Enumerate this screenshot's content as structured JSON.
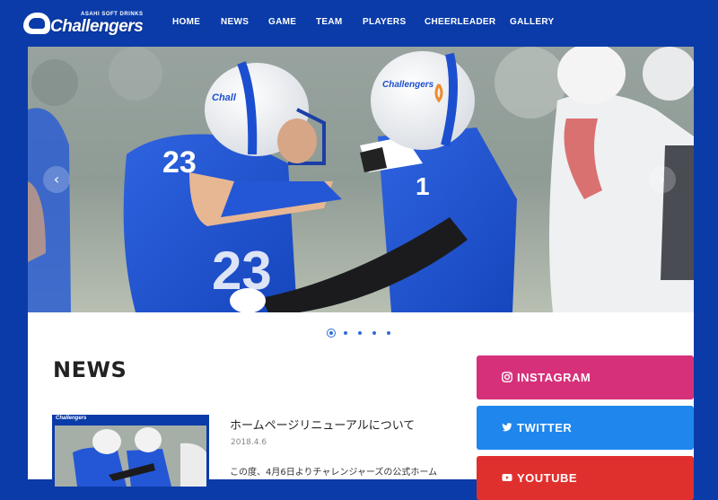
{
  "header": {
    "logo_small": "ASAHI SOFT DRINKS",
    "logo_big": "Challengers",
    "nav": [
      {
        "label": "HOME"
      },
      {
        "label": "NEWS"
      },
      {
        "label": "GAME"
      },
      {
        "label": "TEAM"
      },
      {
        "label": "PLAYERS"
      },
      {
        "label": "CHEERLEADER"
      },
      {
        "label": "GALLERY"
      }
    ]
  },
  "hero": {
    "prev_arrow": "‹",
    "next_arrow": "›",
    "slide_count": 5,
    "active_slide": 1,
    "jersey_left": "23",
    "jersey_center": "1",
    "helmet_text": "Challengers"
  },
  "news": {
    "heading": "NEWS",
    "post": {
      "title": "ホームページリニューアルについて",
      "date": "2018.4.6",
      "excerpt": "この度、4月6日よりチャレンジャーズの公式ホーム"
    },
    "thumb_logo": "Challengers"
  },
  "social": [
    {
      "label": "INSTAGRAM",
      "color": "#d6307a",
      "icon": "instagram-icon"
    },
    {
      "label": "TWITTER",
      "color": "#1f86ee",
      "icon": "twitter-icon"
    },
    {
      "label": "YOUTUBE",
      "color": "#e0302e",
      "icon": "youtube-icon"
    }
  ],
  "colors": {
    "brand_blue": "#0a3ba8",
    "accent_blue": "#2f6ed8"
  }
}
